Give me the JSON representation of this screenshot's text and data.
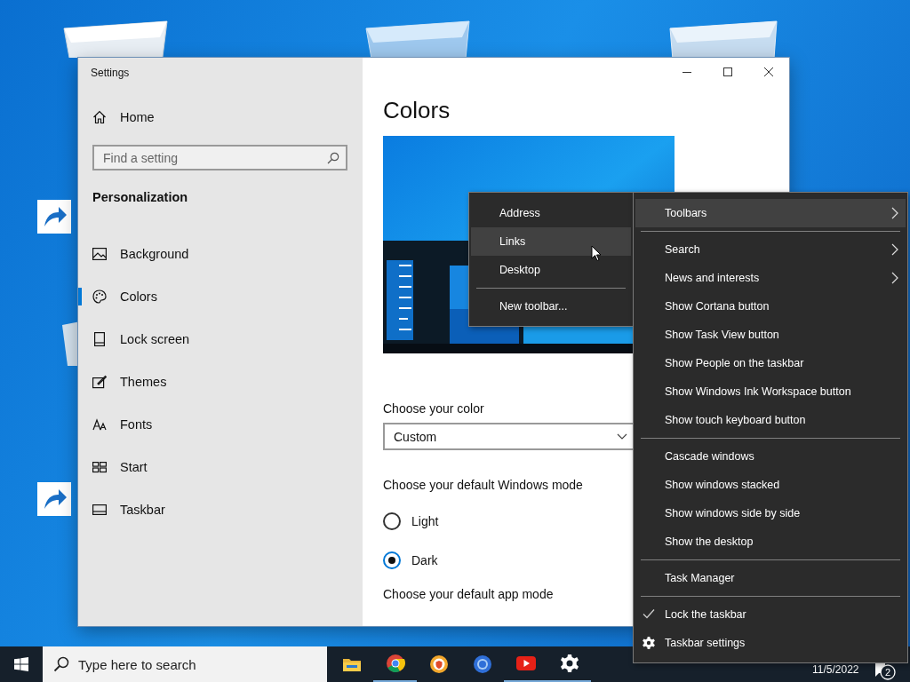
{
  "settings_window": {
    "title": "Settings",
    "home": "Home",
    "search": {
      "placeholder": "Find a setting"
    },
    "section": "Personalization",
    "nav": [
      {
        "label": "Background",
        "selected": false
      },
      {
        "label": "Colors",
        "selected": true
      },
      {
        "label": "Lock screen",
        "selected": false
      },
      {
        "label": "Themes",
        "selected": false
      },
      {
        "label": "Fonts",
        "selected": false
      },
      {
        "label": "Start",
        "selected": false
      },
      {
        "label": "Taskbar",
        "selected": false
      }
    ],
    "heading": "Colors",
    "color_label": "Choose your color",
    "color_dropdown": {
      "value": "Custom"
    },
    "mode_label": "Choose your default Windows mode",
    "mode_options": [
      {
        "label": "Light",
        "selected": false
      },
      {
        "label": "Dark",
        "selected": true
      }
    ],
    "app_mode_label": "Choose your default app mode"
  },
  "context_menu": {
    "items": [
      {
        "kind": "item",
        "label": "Toolbars",
        "submenu": true,
        "highlighted": true
      },
      {
        "kind": "separator"
      },
      {
        "kind": "item",
        "label": "Search",
        "submenu": true,
        "highlighted": false
      },
      {
        "kind": "item",
        "label": "News and interests",
        "submenu": true,
        "highlighted": false
      },
      {
        "kind": "item",
        "label": "Show Cortana button",
        "submenu": false,
        "highlighted": false
      },
      {
        "kind": "item",
        "label": "Show Task View button",
        "submenu": false,
        "highlighted": false
      },
      {
        "kind": "item",
        "label": "Show People on the taskbar",
        "submenu": false,
        "highlighted": false
      },
      {
        "kind": "item",
        "label": "Show Windows Ink Workspace button",
        "submenu": false,
        "highlighted": false
      },
      {
        "kind": "item",
        "label": "Show touch keyboard button",
        "submenu": false,
        "highlighted": false
      },
      {
        "kind": "separator"
      },
      {
        "kind": "item",
        "label": "Cascade windows",
        "submenu": false,
        "highlighted": false
      },
      {
        "kind": "item",
        "label": "Show windows stacked",
        "submenu": false,
        "highlighted": false
      },
      {
        "kind": "item",
        "label": "Show windows side by side",
        "submenu": false,
        "highlighted": false
      },
      {
        "kind": "item",
        "label": "Show the desktop",
        "submenu": false,
        "highlighted": false
      },
      {
        "kind": "separator"
      },
      {
        "kind": "item",
        "label": "Task Manager",
        "submenu": false,
        "highlighted": false
      },
      {
        "kind": "separator"
      },
      {
        "kind": "check",
        "label": "Lock the taskbar",
        "checked": true,
        "highlighted": false
      },
      {
        "kind": "gear",
        "label": "Taskbar settings",
        "highlighted": false
      }
    ]
  },
  "toolbars_submenu": {
    "items": [
      {
        "kind": "item",
        "label": "Address",
        "highlighted": false
      },
      {
        "kind": "item",
        "label": "Links",
        "highlighted": true
      },
      {
        "kind": "item",
        "label": "Desktop",
        "highlighted": false
      },
      {
        "kind": "separator"
      },
      {
        "kind": "item",
        "label": "New toolbar...",
        "highlighted": false
      }
    ]
  },
  "taskbar": {
    "search": {
      "placeholder": "Type here to search"
    },
    "apps": [
      {
        "kind": "folder",
        "running": false
      },
      {
        "kind": "chrome",
        "running": true
      },
      {
        "kind": "shield",
        "running": false
      },
      {
        "kind": "ring",
        "running": false
      },
      {
        "kind": "play",
        "running": true
      },
      {
        "kind": "gear",
        "running": true
      }
    ],
    "date": "11/5/2022",
    "notifications": "2"
  }
}
